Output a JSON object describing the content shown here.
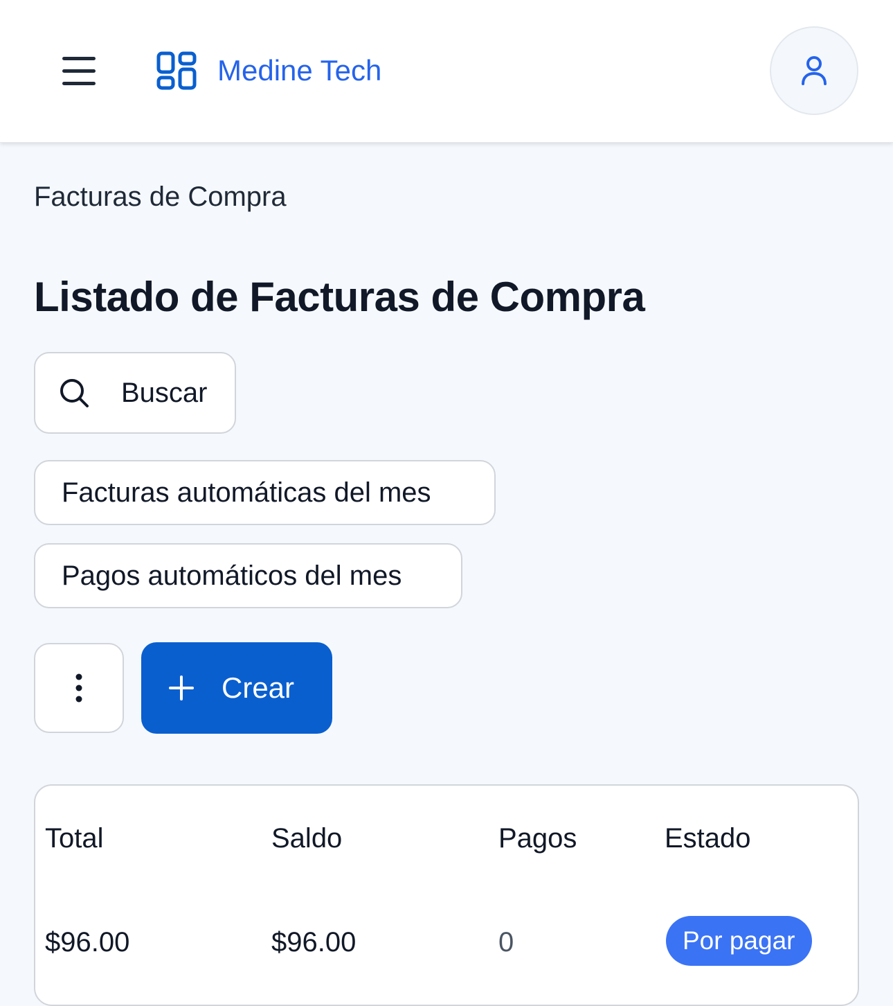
{
  "header": {
    "brand_title": "Medine Tech",
    "icons": {
      "menu": "menu-icon",
      "logo": "grid-logo-icon",
      "user": "user-icon"
    },
    "brand_color": "#2563eb"
  },
  "breadcrumb": "Facturas de Compra",
  "page_title": "Listado de Facturas de Compra",
  "toolbar": {
    "search_label": "Buscar",
    "auto_invoices_label": "Facturas automáticas del mes",
    "auto_payments_label": "Pagos automáticos del mes",
    "create_label": "Crear",
    "create_color": "#0a5fcf"
  },
  "table": {
    "columns": [
      "Total",
      "Saldo",
      "Pagos",
      "Estado"
    ],
    "rows": [
      {
        "total": "$96.00",
        "saldo": "$96.00",
        "pagos": "0",
        "estado": "Por pagar"
      }
    ],
    "status_color": "#3b73f5"
  }
}
